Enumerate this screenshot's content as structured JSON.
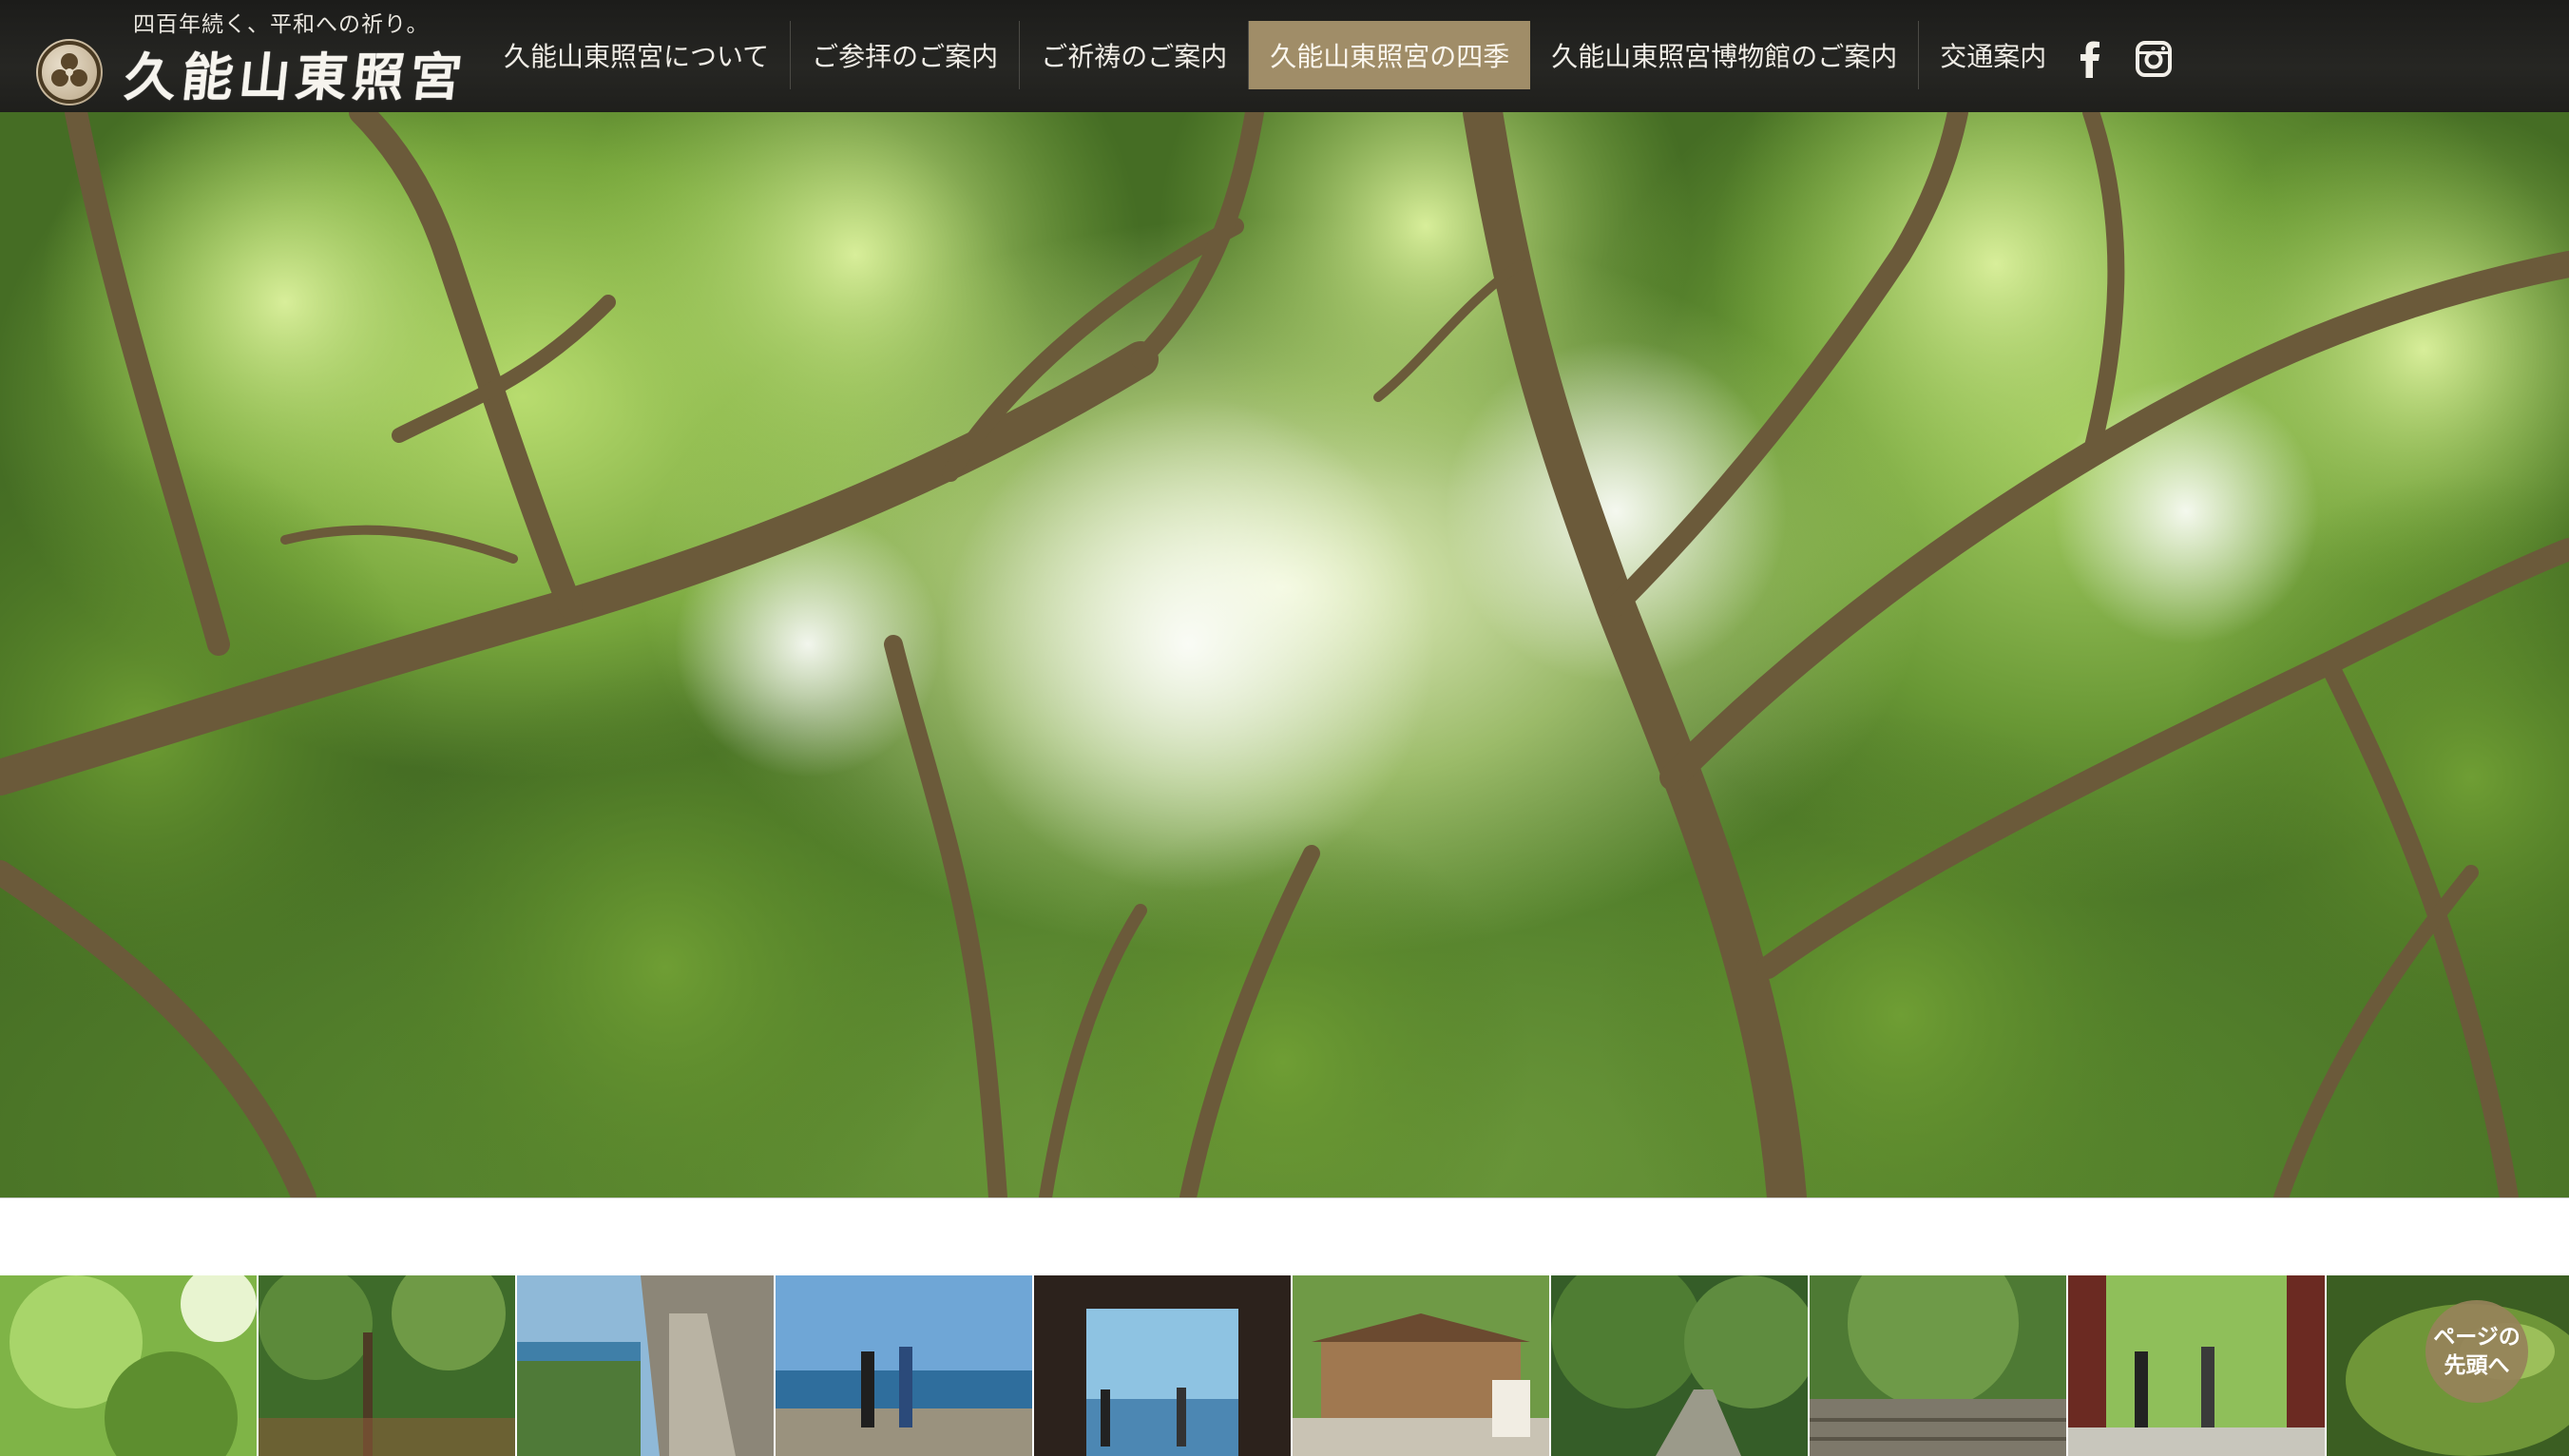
{
  "header": {
    "tagline": "四百年続く、平和への祈り。",
    "logo_text": "久能山東照宮"
  },
  "nav": {
    "items": [
      {
        "label": "久能山東照宮について"
      },
      {
        "label": "ご参拝のご案内"
      },
      {
        "label": "ご祈祷のご案内"
      },
      {
        "label": "久能山東照宮の四季",
        "active": true
      },
      {
        "label": "久能山東照宮博物館のご案内"
      },
      {
        "label": "交通案内"
      }
    ],
    "social": [
      {
        "icon": "facebook-icon"
      },
      {
        "icon": "instagram-icon"
      }
    ],
    "active_color": "#a08d68"
  },
  "hero": {
    "description_icon": "fresh-green-maple-canopy-photo"
  },
  "thumbnails": [
    {
      "icon": "green-maple-leaves-photo"
    },
    {
      "icon": "forest-trees-photo"
    },
    {
      "icon": "stone-stairs-sea-photo"
    },
    {
      "icon": "coastal-lookout-visitors-photo"
    },
    {
      "icon": "gate-view-of-sea-photo"
    },
    {
      "icon": "shrine-stall-visitors-photo"
    },
    {
      "icon": "forest-path-photo"
    },
    {
      "icon": "stone-steps-grove-photo"
    },
    {
      "icon": "red-gate-walkers-photo"
    },
    {
      "icon": "moss-close-up-photo"
    }
  ],
  "page_top": {
    "line1": "ページの",
    "line2": "先頭へ"
  }
}
